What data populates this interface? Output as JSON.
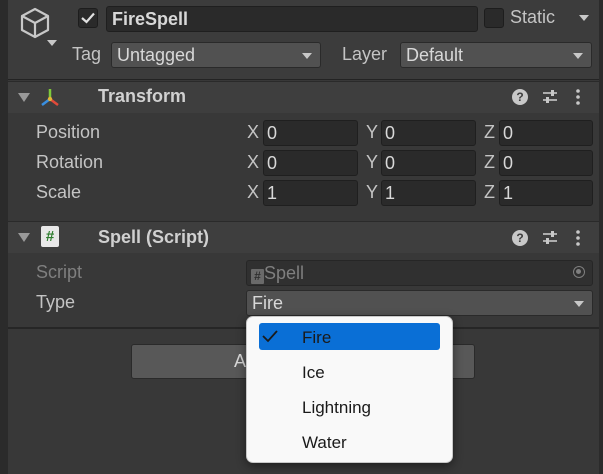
{
  "header": {
    "object_name": "FireSpell",
    "static_label": "Static",
    "tag_label": "Tag",
    "tag_value": "Untagged",
    "layer_label": "Layer",
    "layer_value": "Default"
  },
  "transform": {
    "title": "Transform",
    "rows": [
      {
        "label": "Position",
        "x": "0",
        "y": "0",
        "z": "0"
      },
      {
        "label": "Rotation",
        "x": "0",
        "y": "0",
        "z": "0"
      },
      {
        "label": "Scale",
        "x": "1",
        "y": "1",
        "z": "1"
      }
    ],
    "axes": [
      "X",
      "Y",
      "Z"
    ]
  },
  "spell": {
    "title": "Spell (Script)",
    "script_label": "Script",
    "script_value": "Spell",
    "type_label": "Type",
    "type_value": "Fire",
    "button_partial": "A"
  },
  "popup": {
    "options": [
      "Fire",
      "Ice",
      "Lightning",
      "Water"
    ],
    "selected": "Fire"
  },
  "colors": {
    "background": "#383838",
    "selection": "#0a6fd6"
  }
}
